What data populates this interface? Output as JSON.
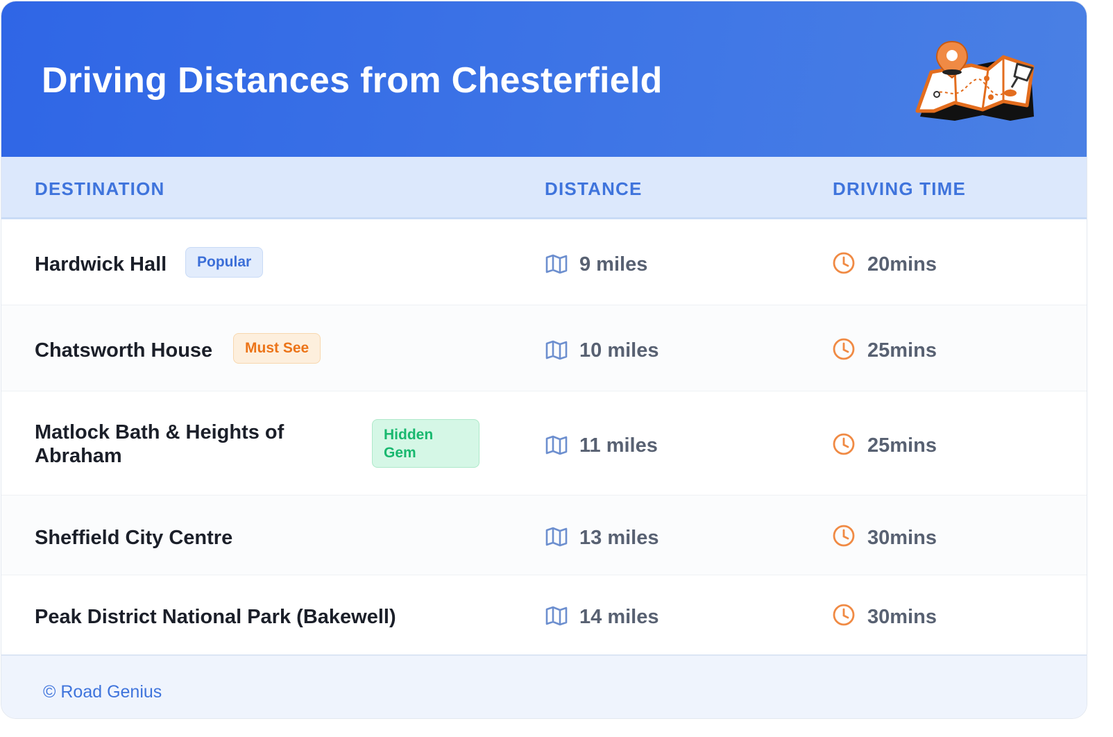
{
  "header": {
    "title": "Driving Distances from Chesterfield",
    "illustration": "map-with-pins-icon"
  },
  "table": {
    "columns": [
      "DESTINATION",
      "DISTANCE",
      "DRIVING TIME"
    ],
    "rows": [
      {
        "destination": "Hardwick Hall",
        "badge": "Popular",
        "badge_color": "#3c6fd8",
        "distance": "9 miles",
        "time": "20mins"
      },
      {
        "destination": "Chatsworth House",
        "badge": "Must See",
        "badge_color": "#ec7418",
        "distance": "10 miles",
        "time": "25mins"
      },
      {
        "destination": "Matlock Bath & Heights of Abraham",
        "badge": "Hidden Gem",
        "badge_color": "#19b86f",
        "distance": "11 miles",
        "time": "25mins"
      },
      {
        "destination": "Sheffield City Centre",
        "badge": "",
        "distance": "13 miles",
        "time": "30mins"
      },
      {
        "destination": "Peak District National Park (Bakewell)",
        "badge": "",
        "distance": "14 miles",
        "time": "30mins"
      }
    ],
    "distance_icon": "map-icon",
    "time_icon": "clock-icon",
    "distance_icon_color": "#6d8fcf",
    "time_icon_color": "#f08a44"
  },
  "footer": {
    "credit": "© Road Genius"
  },
  "colors": {
    "header_bg": "#3a70e6",
    "column_header_bg": "#dce8fc",
    "accent": "#3f74dc"
  }
}
